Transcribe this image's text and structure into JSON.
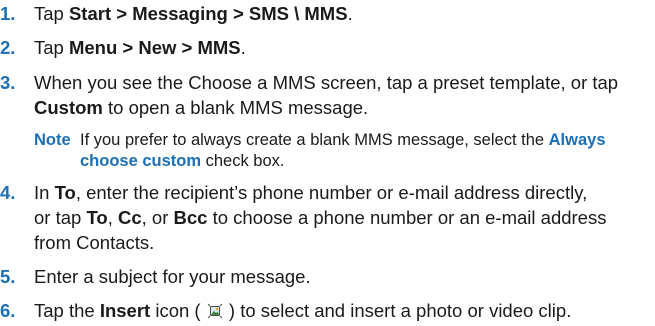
{
  "steps": [
    {
      "number": "1.",
      "t1": "Tap ",
      "b1": "Start > Messaging > SMS \\ MMS",
      "t2": "."
    },
    {
      "number": "2.",
      "t1": "Tap ",
      "b1": "Menu > New > MMS",
      "t2": "."
    },
    {
      "number": "3.",
      "line1": "When you see the Choose a MMS screen, tap a preset template, or tap",
      "b1": "Custom",
      "t2": " to open a blank MMS message."
    },
    {
      "number": "4.",
      "t1": "In ",
      "b1": "To",
      "t2": ", enter the recipient’s phone number or e-mail address directly,",
      "t3": "or tap ",
      "b2": "To",
      "t4": ", ",
      "b3": "Cc",
      "t5": ", or ",
      "b4": "Bcc",
      "t6": " to choose a phone number or an e-mail address",
      "t7": "from Contacts."
    },
    {
      "number": "5.",
      "text": "Enter a subject for your message."
    },
    {
      "number": "6.",
      "t1": "Tap the ",
      "b1": "Insert",
      "t2": " icon ( ",
      "icon": "insert-media-icon",
      "t3": " ) to select and insert a photo or video clip."
    }
  ],
  "note": {
    "label": "Note",
    "t1": "If you prefer to always create a blank MMS message, select the ",
    "b1": "Always",
    "b2": "choose custom",
    "t2": " check box."
  }
}
